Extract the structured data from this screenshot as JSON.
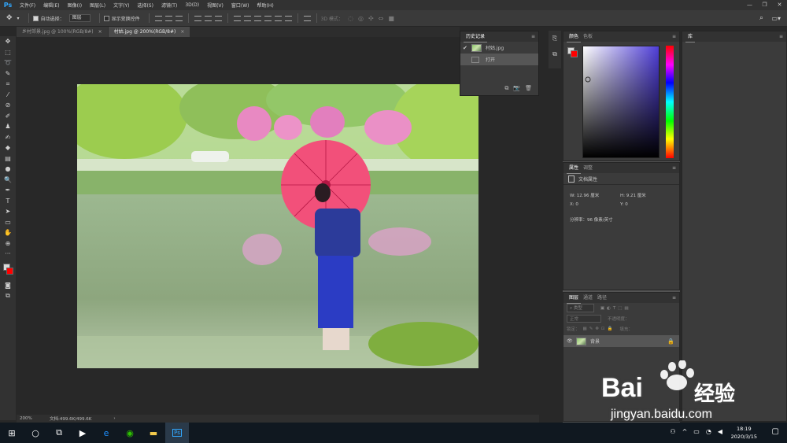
{
  "app": {
    "logo": "Ps",
    "menu": [
      "文件(F)",
      "编辑(E)",
      "图像(I)",
      "图层(L)",
      "文字(Y)",
      "选择(S)",
      "滤镜(T)",
      "3D(D)",
      "视图(V)",
      "窗口(W)",
      "帮助(H)"
    ],
    "win": [
      "—",
      "❐",
      "✕"
    ]
  },
  "options": {
    "auto_select_label": "自动选择：",
    "auto_select_value": "图层",
    "show_transform_label": "显示变换控件",
    "mode3d": "3D 模式："
  },
  "tabs": [
    {
      "label": "乡村郊景.jpg @ 100%(RGB/8#)",
      "close": "×"
    },
    {
      "label": "村姑.jpg @ 200%(RGB/8#)",
      "close": "×"
    }
  ],
  "history": {
    "tabs": [
      "历史记录"
    ],
    "rows": [
      "村姑.jpg",
      "打开"
    ]
  },
  "color": {
    "tabs": [
      "颜色",
      "色板"
    ],
    "fg": "#d9d9d9",
    "bg": "#ff0000",
    "hue": "#4f3ed8"
  },
  "props": {
    "tabs": [
      "属性",
      "调整"
    ],
    "title": "文档属性",
    "w": "W:  12.96 厘米",
    "h": "H:  9.21 厘米",
    "x": "X:  0",
    "y": "Y:  0",
    "res": "分辨率：96 像素/英寸"
  },
  "layers": {
    "tabs": [
      "图层",
      "通道",
      "路径"
    ],
    "filter": "类型",
    "blend": "正常",
    "opacity": "不透明度：",
    "lock": "锁定：",
    "fill": "填充：",
    "layer_name": "背景"
  },
  "lib": {
    "title": "库"
  },
  "status": {
    "zoom": "200%",
    "doc": "文档:499.6K/499.6K"
  },
  "taskbar": {
    "time": "18:19",
    "date": "2020/3/15"
  },
  "watermark": {
    "brand": "Bai",
    "brand2": "经验",
    "url": "jingyan.baidu.com"
  }
}
